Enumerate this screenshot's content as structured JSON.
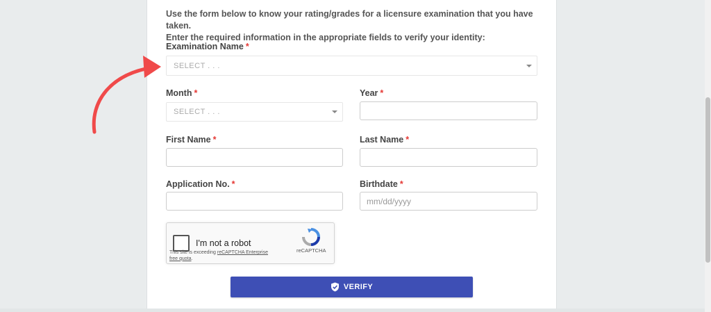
{
  "intro": {
    "line1": "Use the form below to know your rating/grades for a licensure examination that you have taken.",
    "line2": "Enter the required information in the appropriate fields to verify your identity:"
  },
  "form": {
    "required_mark": "*",
    "exam_name": {
      "label": "Examination Name",
      "value": "SELECT . . ."
    },
    "month": {
      "label": "Month",
      "value": "SELECT . . ."
    },
    "year": {
      "label": "Year",
      "value": ""
    },
    "first_name": {
      "label": "First Name",
      "value": ""
    },
    "last_name": {
      "label": "Last Name",
      "value": ""
    },
    "application_no": {
      "label": "Application No.",
      "value": ""
    },
    "birthdate": {
      "label": "Birthdate",
      "placeholder": "mm/dd/yyyy"
    }
  },
  "captcha": {
    "label": "I'm not a robot",
    "brand": "reCAPTCHA",
    "warning_prefix": "This site is exceeding ",
    "warning_link": "reCAPTCHA Enterprise free quota",
    "warning_suffix": "."
  },
  "verify_button": {
    "label": "VERIFY",
    "icon": "shield-check-icon"
  },
  "colors": {
    "accent": "#3e4fb5",
    "required": "#e53935",
    "annotation_arrow": "#f04a4a",
    "background": "#e9eced"
  }
}
